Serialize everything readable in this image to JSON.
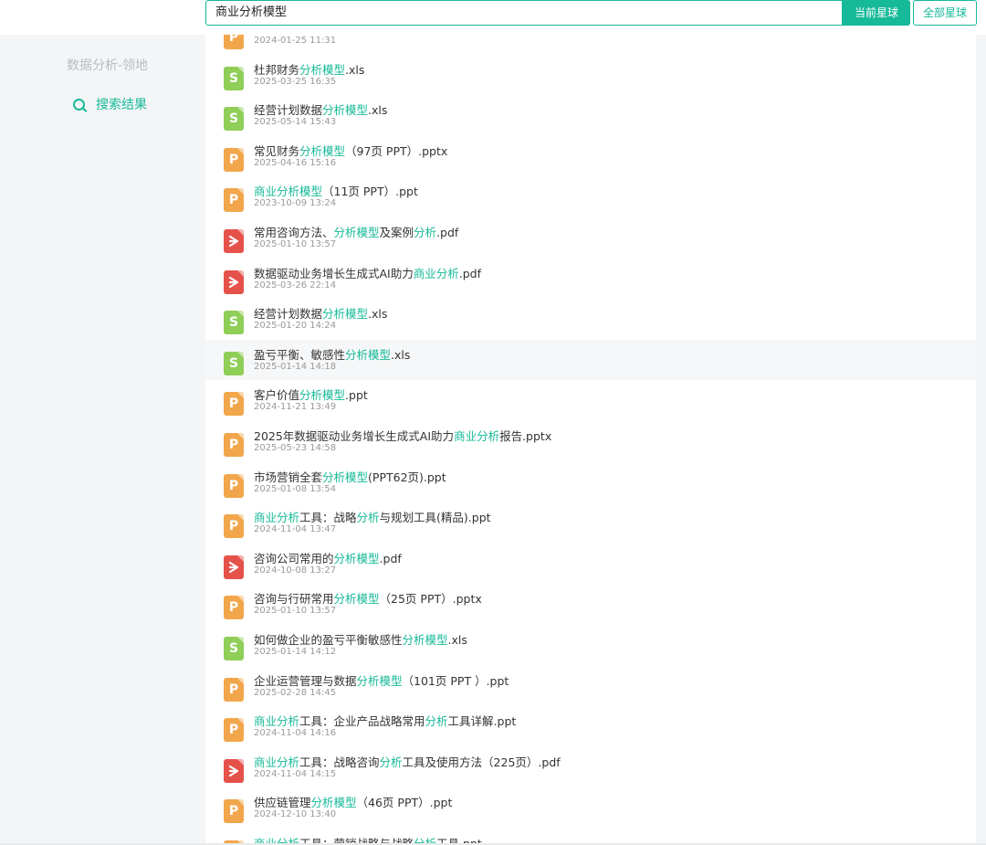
{
  "search": {
    "query": "商业分析模型"
  },
  "buttons": {
    "current_planet": "当前星球",
    "all_planets": "全部星球"
  },
  "sidebar": {
    "title": "数据分析-领地",
    "search_results_label": "搜索结果"
  },
  "colors": {
    "accent": "#16b998",
    "xls": "#8fce57",
    "ppt": "#f2a64b",
    "pdf": "#e5524a"
  },
  "results": [
    {
      "type": "ppt",
      "icon": "ppt-file-icon",
      "letter": "P",
      "parts": [],
      "date": "2024-01-25 11:31"
    },
    {
      "type": "xls",
      "icon": "spreadsheet-file-icon",
      "letter": "S",
      "parts": [
        {
          "t": "杜邦财务"
        },
        {
          "t": "分析模型",
          "h": true
        },
        {
          "t": ".xls"
        }
      ],
      "date": "2025-03-25 16:35"
    },
    {
      "type": "xls",
      "icon": "spreadsheet-file-icon",
      "letter": "S",
      "parts": [
        {
          "t": "经营计划数据"
        },
        {
          "t": "分析模型",
          "h": true
        },
        {
          "t": ".xls"
        }
      ],
      "date": "2025-05-14 15:43"
    },
    {
      "type": "ppt",
      "icon": "ppt-file-icon",
      "letter": "P",
      "parts": [
        {
          "t": "常见财务"
        },
        {
          "t": "分析模型",
          "h": true
        },
        {
          "t": "（97页 PPT）.pptx"
        }
      ],
      "date": "2025-04-16 15:16"
    },
    {
      "type": "ppt",
      "icon": "ppt-file-icon",
      "letter": "P",
      "parts": [
        {
          "t": "商业分析模型",
          "h": true
        },
        {
          "t": "（11页 PPT）.ppt"
        }
      ],
      "date": "2023-10-09 13:24"
    },
    {
      "type": "pdf",
      "icon": "pdf-file-icon",
      "letter": "",
      "parts": [
        {
          "t": "常用咨询方法、"
        },
        {
          "t": "分析模型",
          "h": true
        },
        {
          "t": "及案例"
        },
        {
          "t": "分析",
          "h": true
        },
        {
          "t": ".pdf"
        }
      ],
      "date": "2025-01-10 13:57"
    },
    {
      "type": "pdf",
      "icon": "pdf-file-icon",
      "letter": "",
      "parts": [
        {
          "t": "数据驱动业务增长生成式AI助力"
        },
        {
          "t": "商业分析",
          "h": true
        },
        {
          "t": ".pdf"
        }
      ],
      "date": "2025-03-26 22:14"
    },
    {
      "type": "xls",
      "icon": "spreadsheet-file-icon",
      "letter": "S",
      "parts": [
        {
          "t": "经营计划数据"
        },
        {
          "t": "分析模型",
          "h": true
        },
        {
          "t": ".xls"
        }
      ],
      "date": "2025-01-20 14:24"
    },
    {
      "type": "xls",
      "icon": "spreadsheet-file-icon",
      "letter": "S",
      "hover": true,
      "parts": [
        {
          "t": "盈亏平衡、敏感性"
        },
        {
          "t": "分析模型",
          "h": true
        },
        {
          "t": ".xls"
        }
      ],
      "date": "2025-01-14 14:18"
    },
    {
      "type": "ppt",
      "icon": "ppt-file-icon",
      "letter": "P",
      "parts": [
        {
          "t": "客户价值"
        },
        {
          "t": "分析模型",
          "h": true
        },
        {
          "t": ".ppt"
        }
      ],
      "date": "2024-11-21 13:49"
    },
    {
      "type": "ppt",
      "icon": "ppt-file-icon",
      "letter": "P",
      "parts": [
        {
          "t": "2025年数据驱动业务增长生成式AI助力"
        },
        {
          "t": "商业分析",
          "h": true
        },
        {
          "t": "报告.pptx"
        }
      ],
      "date": "2025-05-23 14:58"
    },
    {
      "type": "ppt",
      "icon": "ppt-file-icon",
      "letter": "P",
      "parts": [
        {
          "t": "市场营销全套"
        },
        {
          "t": "分析模型",
          "h": true
        },
        {
          "t": "(PPT62页).ppt"
        }
      ],
      "date": "2025-01-08 13:54"
    },
    {
      "type": "ppt",
      "icon": "ppt-file-icon",
      "letter": "P",
      "parts": [
        {
          "t": "商业分析",
          "h": true
        },
        {
          "t": "工具：战略"
        },
        {
          "t": "分析",
          "h": true
        },
        {
          "t": "与规划工具(精品).ppt"
        }
      ],
      "date": "2024-11-04 13:47"
    },
    {
      "type": "pdf",
      "icon": "pdf-file-icon",
      "letter": "",
      "parts": [
        {
          "t": "咨询公司常用的"
        },
        {
          "t": "分析模型",
          "h": true
        },
        {
          "t": ".pdf"
        }
      ],
      "date": "2024-10-08 13:27"
    },
    {
      "type": "ppt",
      "icon": "ppt-file-icon",
      "letter": "P",
      "parts": [
        {
          "t": "咨询与行研常用"
        },
        {
          "t": "分析模型",
          "h": true
        },
        {
          "t": "（25页 PPT）.pptx"
        }
      ],
      "date": "2025-01-10 13:57"
    },
    {
      "type": "xls",
      "icon": "spreadsheet-file-icon",
      "letter": "S",
      "parts": [
        {
          "t": "如何做企业的盈亏平衡敏感性"
        },
        {
          "t": "分析模型",
          "h": true
        },
        {
          "t": ".xls"
        }
      ],
      "date": "2025-01-14 14:12"
    },
    {
      "type": "ppt",
      "icon": "ppt-file-icon",
      "letter": "P",
      "parts": [
        {
          "t": "企业运营管理与数据"
        },
        {
          "t": "分析模型",
          "h": true
        },
        {
          "t": "（101页 PPT ）.ppt"
        }
      ],
      "date": "2025-02-28 14:45"
    },
    {
      "type": "ppt",
      "icon": "ppt-file-icon",
      "letter": "P",
      "parts": [
        {
          "t": "商业分析",
          "h": true
        },
        {
          "t": "工具：企业产品战略常用"
        },
        {
          "t": "分析",
          "h": true
        },
        {
          "t": "工具详解.ppt"
        }
      ],
      "date": "2024-11-04 14:16"
    },
    {
      "type": "pdf",
      "icon": "pdf-file-icon",
      "letter": "",
      "parts": [
        {
          "t": "商业分析",
          "h": true
        },
        {
          "t": "工具：战略咨询"
        },
        {
          "t": "分析",
          "h": true
        },
        {
          "t": "工具及使用方法（225页）.pdf"
        }
      ],
      "date": "2024-11-04 14:15"
    },
    {
      "type": "ppt",
      "icon": "ppt-file-icon",
      "letter": "P",
      "parts": [
        {
          "t": "供应链管理"
        },
        {
          "t": "分析模型",
          "h": true
        },
        {
          "t": "（46页 PPT）.ppt"
        }
      ],
      "date": "2024-12-10 13:40"
    },
    {
      "type": "ppt",
      "icon": "ppt-file-icon",
      "letter": "P",
      "parts": [
        {
          "t": "商业分析",
          "h": true
        },
        {
          "t": "工具：营销战略与战略"
        },
        {
          "t": "分析",
          "h": true
        },
        {
          "t": "工具.ppt"
        }
      ],
      "date": ""
    }
  ]
}
